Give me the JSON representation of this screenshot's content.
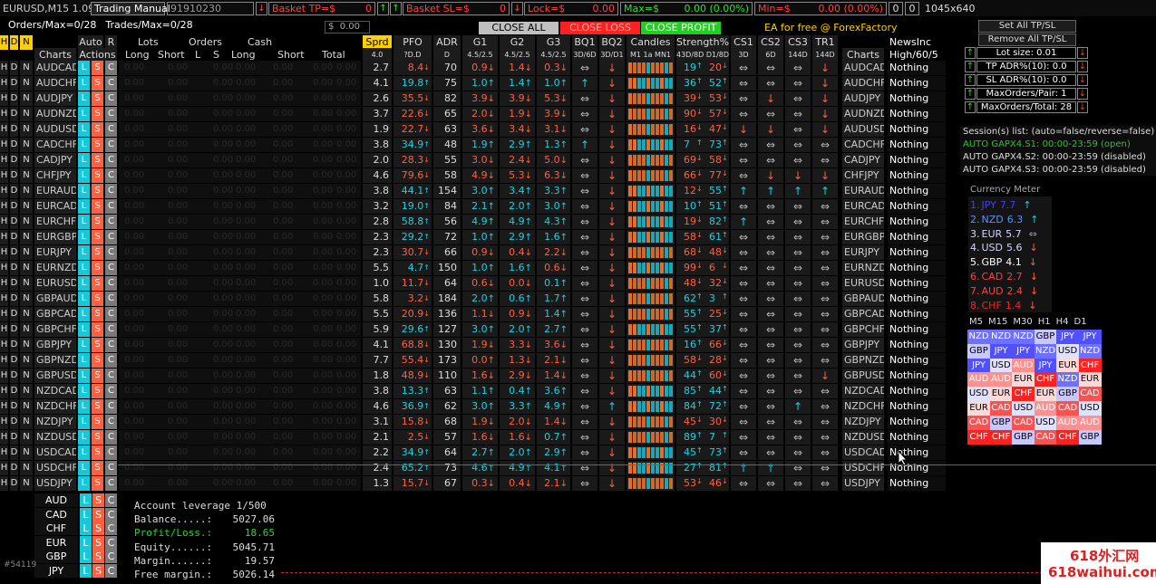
{
  "topbar": {
    "symbol": "EURUSD,M15",
    "version_label": "1.09",
    "trading_manual_label": "Trading Manual",
    "account_field": "91910230",
    "basket_tp_label": "Basket TP=$",
    "basket_tp_value": "0",
    "basket_sl_label": "Basket SL=$",
    "basket_sl_value": "0",
    "lock_label": "Lock=$",
    "lock_value": "0.00",
    "max_label": "Max=$",
    "max_value": "0.00 (0.00%)",
    "min_label": "Min=$",
    "min_value": "0.00 (0.00%)",
    "counter_a": "0",
    "counter_b": "0",
    "resolution": "1045x640"
  },
  "status": {
    "orders": "Orders/Max=0/28",
    "trades": "Trades/Max=0/28",
    "cash_prefix": "$",
    "cash_value": "0.00"
  },
  "actions": {
    "close_all": "CLOSE ALL",
    "close_loss": "CLOSE LOSS",
    "close_profit": "CLOSE PROFIT",
    "ea_free": "EA for free @ ForexFactory"
  },
  "headers": {
    "h": "H",
    "d": "D",
    "n": "N",
    "charts": "Charts",
    "auto": "Auto",
    "r": "R",
    "actions": "Actions",
    "lots": "Lots",
    "orders": "Orders",
    "cash": "Cash",
    "long": "Long",
    "short": "Short",
    "l": "L",
    "s": "S",
    "cash_long": "Long",
    "cash_short": "Short",
    "total": "Total",
    "sprd": "Sprd",
    "sprd_sub": "4.0",
    "pfo": "PFO",
    "pfo_sub": "?D.D",
    "adr": "ADR",
    "adr_sub": "D",
    "g1": "G1",
    "g1_sub": "4.5/2.5",
    "g2": "G2",
    "g2_sub": "4.5/2.5",
    "g3": "G3",
    "g3_sub": "4.5/2.5",
    "bq1": "BQ1",
    "bq1_sub": "3D/6D",
    "bq2": "BQ2",
    "bq2_sub": "3D/D1",
    "candles": "Candles",
    "candles_sub": "M1 1a MN1",
    "strength": "Strength%",
    "strength_sub": "43D/8D D1/8D",
    "cs1": "CS1",
    "cs1_sub": "3D",
    "cs2": "CS2",
    "cs2_sub": "6D",
    "cs3": "CS3",
    "cs3_sub": "144D",
    "tr1": "TR1",
    "tr1_sub": "144D",
    "charts2": "Charts",
    "newsinc": "NewsInc",
    "newsinc_sub": "High/60/5"
  },
  "row_letters": {
    "h": "H",
    "d": "D",
    "n": "N",
    "l": "L",
    "s": "S",
    "c": "C",
    "zero": "0.00",
    "news": "Nothing"
  },
  "pairs": [
    {
      "p": "AUDCAD",
      "sp": "2.7",
      "pfo": "8.4",
      "pc": "salmon",
      "adr": "70",
      "g1": "0.9",
      "g1c": "salmon",
      "g1a": "↓",
      "g2": "1.4",
      "g2c": "salmon",
      "g2a": "↓",
      "g3": "0.3",
      "g3c": "salmon",
      "g3a": "↓",
      "bq1": "⇔",
      "bq2": "↓",
      "s1": "19",
      "s1c": "cyan",
      "s2": "20",
      "s2c": "salmon",
      "cs1": "⇔",
      "cs2": "⇔",
      "cs3": "⇔",
      "tr": "↓"
    },
    {
      "p": "AUDCHF",
      "sp": "4.1",
      "pfo": "19.8",
      "pc": "cyan",
      "adr": "75",
      "g1": "1.0",
      "g1c": "cyan",
      "g1a": "↑",
      "g2": "1.4",
      "g2c": "cyan",
      "g2a": "↑",
      "g3": "1.0",
      "g3c": "cyan",
      "g3a": "↑",
      "bq1": "↑",
      "bq2": "↓",
      "s1": "36",
      "s1c": "cyan",
      "s2": "52",
      "s2c": "cyan",
      "cs1": "⇔",
      "cs2": "⇔",
      "cs3": "⇔",
      "tr": "↓"
    },
    {
      "p": "AUDJPY",
      "sp": "2.6",
      "pfo": "35.5",
      "pc": "salmon",
      "adr": "82",
      "g1": "3.9",
      "g1c": "salmon",
      "g1a": "↓",
      "g2": "3.9",
      "g2c": "salmon",
      "g2a": "↓",
      "g3": "5.3",
      "g3c": "salmon",
      "g3a": "↓",
      "bq1": "⇔",
      "bq2": "↓",
      "s1": "39",
      "s1c": "salmon",
      "s2": "53",
      "s2c": "salmon",
      "cs1": "⇔",
      "cs2": "↓",
      "cs3": "⇔",
      "tr": "↓"
    },
    {
      "p": "AUDNZD",
      "sp": "3.7",
      "pfo": "22.6",
      "pc": "salmon",
      "adr": "65",
      "g1": "2.0",
      "g1c": "salmon",
      "g1a": "↓",
      "g2": "1.9",
      "g2c": "salmon",
      "g2a": "↓",
      "g3": "3.9",
      "g3c": "salmon",
      "g3a": "↓",
      "bq1": "⇔",
      "bq2": "↓",
      "s1": "90",
      "s1c": "salmon",
      "s2": "57",
      "s2c": "salmon",
      "cs1": "⇔",
      "cs2": "⇔",
      "cs3": "⇔",
      "tr": "↓"
    },
    {
      "p": "AUDUSD",
      "sp": "1.9",
      "pfo": "22.7",
      "pc": "salmon",
      "adr": "63",
      "g1": "3.6",
      "g1c": "salmon",
      "g1a": "↓",
      "g2": "3.4",
      "g2c": "salmon",
      "g2a": "↓",
      "g3": "3.1",
      "g3c": "salmon",
      "g3a": "↓",
      "bq1": "⇔",
      "bq2": "↓",
      "s1": "16",
      "s1c": "salmon",
      "s2": "47",
      "s2c": "salmon",
      "cs1": "↓",
      "cs2": "↓",
      "cs3": "⇔",
      "tr": "↓"
    },
    {
      "p": "CADCHF",
      "sp": "3.8",
      "pfo": "34.9",
      "pc": "cyan",
      "adr": "48",
      "g1": "1.9",
      "g1c": "cyan",
      "g1a": "↑",
      "g2": "2.9",
      "g2c": "cyan",
      "g2a": "↑",
      "g3": "1.3",
      "g3c": "cyan",
      "g3a": "↑",
      "bq1": "↑",
      "bq2": "↓",
      "s1": "7",
      "s1c": "cyan",
      "s2": "73",
      "s2c": "cyan",
      "cs1": "⇔",
      "cs2": "⇔",
      "cs3": "⇔",
      "tr": "⇔"
    },
    {
      "p": "CADJPY",
      "sp": "2.0",
      "pfo": "28.3",
      "pc": "salmon",
      "adr": "55",
      "g1": "3.0",
      "g1c": "salmon",
      "g1a": "↓",
      "g2": "2.4",
      "g2c": "salmon",
      "g2a": "↓",
      "g3": "5.0",
      "g3c": "salmon",
      "g3a": "↓",
      "bq1": "⇔",
      "bq2": "↓",
      "s1": "69",
      "s1c": "salmon",
      "s2": "58",
      "s2c": "salmon",
      "cs1": "⇔",
      "cs2": "⇔",
      "cs3": "⇔",
      "tr": "⇔"
    },
    {
      "p": "CHFJPY",
      "sp": "4.6",
      "pfo": "79.6",
      "pc": "salmon",
      "adr": "58",
      "g1": "4.9",
      "g1c": "salmon",
      "g1a": "↓",
      "g2": "5.3",
      "g2c": "salmon",
      "g2a": "↓",
      "g3": "6.3",
      "g3c": "salmon",
      "g3a": "↓",
      "bq1": "⇔",
      "bq2": "↓",
      "s1": "66",
      "s1c": "salmon",
      "s2": "77",
      "s2c": "salmon",
      "cs1": "⇔",
      "cs2": "↓",
      "cs3": "↓",
      "tr": "↓"
    },
    {
      "p": "EURAUD",
      "sp": "3.8",
      "pfo": "44.1",
      "pc": "cyan",
      "adr": "154",
      "g1": "3.0",
      "g1c": "cyan",
      "g1a": "↑",
      "g2": "3.4",
      "g2c": "cyan",
      "g2a": "↑",
      "g3": "3.3",
      "g3c": "cyan",
      "g3a": "↑",
      "bq1": "⇔",
      "bq2": "↓",
      "s1": "12",
      "s1c": "salmon",
      "s2": "55",
      "s2c": "cyan",
      "cs1": "↑",
      "cs2": "↑",
      "cs3": "↑",
      "tr": "↑"
    },
    {
      "p": "EURCAD",
      "sp": "3.2",
      "pfo": "19.0",
      "pc": "cyan",
      "adr": "84",
      "g1": "2.1",
      "g1c": "cyan",
      "g1a": "↑",
      "g2": "2.0",
      "g2c": "cyan",
      "g2a": "↑",
      "g3": "3.0",
      "g3c": "cyan",
      "g3a": "↑",
      "bq1": "⇔",
      "bq2": "↓",
      "s1": "10",
      "s1c": "cyan",
      "s2": "51",
      "s2c": "cyan",
      "cs1": "⇔",
      "cs2": "⇔",
      "cs3": "⇔",
      "tr": "⇔"
    },
    {
      "p": "EURCHF",
      "sp": "2.8",
      "pfo": "58.8",
      "pc": "cyan",
      "adr": "56",
      "g1": "4.9",
      "g1c": "cyan",
      "g1a": "↑",
      "g2": "4.9",
      "g2c": "cyan",
      "g2a": "↑",
      "g3": "4.3",
      "g3c": "cyan",
      "g3a": "↑",
      "bq1": "⇔",
      "bq2": "↓",
      "s1": "19",
      "s1c": "salmon",
      "s2": "82",
      "s2c": "cyan",
      "cs1": "↑",
      "cs2": "⇔",
      "cs3": "⇔",
      "tr": "⇔"
    },
    {
      "p": "EURGBP",
      "sp": "2.3",
      "pfo": "29.2",
      "pc": "cyan",
      "adr": "72",
      "g1": "1.0",
      "g1c": "cyan",
      "g1a": "↑",
      "g2": "2.9",
      "g2c": "cyan",
      "g2a": "↑",
      "g3": "1.6",
      "g3c": "cyan",
      "g3a": "↑",
      "bq1": "⇔",
      "bq2": "↓",
      "s1": "58",
      "s1c": "salmon",
      "s2": "61",
      "s2c": "cyan",
      "cs1": "⇔",
      "cs2": "⇔",
      "cs3": "⇔",
      "tr": "⇔"
    },
    {
      "p": "EURJPY",
      "sp": "2.3",
      "pfo": "30.7",
      "pc": "salmon",
      "adr": "66",
      "g1": "0.9",
      "g1c": "salmon",
      "g1a": "↓",
      "g2": "0.4",
      "g2c": "salmon",
      "g2a": "↓",
      "g3": "2.2",
      "g3c": "salmon",
      "g3a": "↓",
      "bq1": "⇔",
      "bq2": "↓",
      "s1": "68",
      "s1c": "salmon",
      "s2": "48",
      "s2c": "salmon",
      "cs1": "⇔",
      "cs2": "⇔",
      "cs3": "⇔",
      "tr": "⇔"
    },
    {
      "p": "EURNZD",
      "sp": "5.5",
      "pfo": "4.7",
      "pc": "cyan",
      "adr": "150",
      "g1": "1.0",
      "g1c": "cyan",
      "g1a": "↑",
      "g2": "1.6",
      "g2c": "cyan",
      "g2a": "↑",
      "g3": "0.6",
      "g3c": "salmon",
      "g3a": "↓",
      "bq1": "⇔",
      "bq2": "↓",
      "s1": "99",
      "s1c": "salmon",
      "s2": "6",
      "s2c": "salmon",
      "cs1": "⇔",
      "cs2": "⇔",
      "cs3": "⇔",
      "tr": "⇔"
    },
    {
      "p": "EURUSD",
      "sp": "1.0",
      "pfo": "11.7",
      "pc": "salmon",
      "adr": "64",
      "g1": "0.6",
      "g1c": "salmon",
      "g1a": "↓",
      "g2": "0.0",
      "g2c": "salmon",
      "g2a": "↓",
      "g3": "0.1",
      "g3c": "cyan",
      "g3a": "↑",
      "bq1": "⇔",
      "bq2": "↓",
      "s1": "48",
      "s1c": "salmon",
      "s2": "32",
      "s2c": "salmon",
      "cs1": "⇔",
      "cs2": "⇔",
      "cs3": "⇔",
      "tr": "⇔"
    },
    {
      "p": "GBPAUD",
      "sp": "5.8",
      "pfo": "3.2",
      "pc": "salmon",
      "adr": "184",
      "g1": "2.0",
      "g1c": "cyan",
      "g1a": "↑",
      "g2": "0.6",
      "g2c": "cyan",
      "g2a": "↑",
      "g3": "1.7",
      "g3c": "cyan",
      "g3a": "↑",
      "bq1": "⇔",
      "bq2": "↓",
      "s1": "62",
      "s1c": "cyan",
      "s2": "3",
      "s2c": "cyan",
      "cs1": "⇔",
      "cs2": "⇔",
      "cs3": "⇔",
      "tr": "⇔"
    },
    {
      "p": "GBPCAD",
      "sp": "5.5",
      "pfo": "20.9",
      "pc": "salmon",
      "adr": "136",
      "g1": "1.1",
      "g1c": "salmon",
      "g1a": "↓",
      "g2": "0.9",
      "g2c": "salmon",
      "g2a": "↓",
      "g3": "1.4",
      "g3c": "cyan",
      "g3a": "↑",
      "bq1": "⇔",
      "bq2": "↓",
      "s1": "55",
      "s1c": "cyan",
      "s2": "25",
      "s2c": "salmon",
      "cs1": "⇔",
      "cs2": "⇔",
      "cs3": "⇔",
      "tr": "⇔"
    },
    {
      "p": "GBPCHF",
      "sp": "5.9",
      "pfo": "29.6",
      "pc": "cyan",
      "adr": "127",
      "g1": "3.0",
      "g1c": "cyan",
      "g1a": "↑",
      "g2": "2.0",
      "g2c": "cyan",
      "g2a": "↑",
      "g3": "2.7",
      "g3c": "cyan",
      "g3a": "↑",
      "bq1": "⇔",
      "bq2": "↓",
      "s1": "55",
      "s1c": "cyan",
      "s2": "37",
      "s2c": "cyan",
      "cs1": "⇔",
      "cs2": "⇔",
      "cs3": "⇔",
      "tr": "⇔"
    },
    {
      "p": "GBPJPY",
      "sp": "4.1",
      "pfo": "68.8",
      "pc": "salmon",
      "adr": "130",
      "g1": "1.9",
      "g1c": "salmon",
      "g1a": "↓",
      "g2": "3.3",
      "g2c": "salmon",
      "g2a": "↓",
      "g3": "3.6",
      "g3c": "salmon",
      "g3a": "↓",
      "bq1": "⇔",
      "bq2": "↓",
      "s1": "16",
      "s1c": "cyan",
      "s2": "66",
      "s2c": "salmon",
      "cs1": "⇔",
      "cs2": "⇔",
      "cs3": "⇔",
      "tr": "⇔"
    },
    {
      "p": "GBPNZD",
      "sp": "7.7",
      "pfo": "55.4",
      "pc": "salmon",
      "adr": "173",
      "g1": "0.0",
      "g1c": "salmon",
      "g1a": "↑",
      "g2": "1.3",
      "g2c": "salmon",
      "g2a": "↓",
      "g3": "2.1",
      "g3c": "salmon",
      "g3a": "↓",
      "bq1": "⇔",
      "bq2": "↓",
      "s1": "58",
      "s1c": "salmon",
      "s2": "28",
      "s2c": "salmon",
      "cs1": "⇔",
      "cs2": "⇔",
      "cs3": "⇔",
      "tr": "⇔"
    },
    {
      "p": "GBPUSD",
      "sp": "1.8",
      "pfo": "48.9",
      "pc": "salmon",
      "adr": "110",
      "g1": "1.6",
      "g1c": "salmon",
      "g1a": "↓",
      "g2": "2.9",
      "g2c": "salmon",
      "g2a": "↓",
      "g3": "1.4",
      "g3c": "salmon",
      "g3a": "↓",
      "bq1": "⇔",
      "bq2": "↓",
      "s1": "44",
      "s1c": "cyan",
      "s2": "60",
      "s2c": "salmon",
      "cs1": "⇔",
      "cs2": "⇔",
      "cs3": "⇔",
      "tr": "↓"
    },
    {
      "p": "NZDCAD",
      "sp": "3.8",
      "pfo": "13.3",
      "pc": "cyan",
      "adr": "63",
      "g1": "1.1",
      "g1c": "cyan",
      "g1a": "↑",
      "g2": "0.4",
      "g2c": "cyan",
      "g2a": "↑",
      "g3": "3.6",
      "g3c": "cyan",
      "g3a": "↑",
      "bq1": "⇔",
      "bq2": "↓",
      "s1": "85",
      "s1c": "cyan",
      "s2": "44",
      "s2c": "cyan",
      "cs1": "⇔",
      "cs2": "⇔",
      "cs3": "⇔",
      "tr": "⇔"
    },
    {
      "p": "NZDCHF",
      "sp": "4.6",
      "pfo": "36.9",
      "pc": "cyan",
      "adr": "62",
      "g1": "3.0",
      "g1c": "cyan",
      "g1a": "↑",
      "g2": "3.3",
      "g2c": "cyan",
      "g2a": "↑",
      "g3": "4.9",
      "g3c": "cyan",
      "g3a": "↑",
      "bq1": "⇔",
      "bq2": "↑",
      "s1": "84",
      "s1c": "cyan",
      "s2": "72",
      "s2c": "cyan",
      "cs1": "⇔",
      "cs2": "⇔",
      "cs3": "↑",
      "tr": "⇔"
    },
    {
      "p": "NZDJPY",
      "sp": "3.1",
      "pfo": "15.8",
      "pc": "salmon",
      "adr": "68",
      "g1": "1.9",
      "g1c": "salmon",
      "g1a": "↓",
      "g2": "2.0",
      "g2c": "salmon",
      "g2a": "↓",
      "g3": "1.4",
      "g3c": "salmon",
      "g3a": "↓",
      "bq1": "⇔",
      "bq2": "↓",
      "s1": "45",
      "s1c": "salmon",
      "s2": "30",
      "s2c": "salmon",
      "cs1": "⇔",
      "cs2": "⇔",
      "cs3": "⇔",
      "tr": "⇔"
    },
    {
      "p": "NZDUSD",
      "sp": "2.1",
      "pfo": "2.5",
      "pc": "salmon",
      "adr": "57",
      "g1": "1.6",
      "g1c": "salmon",
      "g1a": "↓",
      "g2": "1.6",
      "g2c": "salmon",
      "g2a": "↓",
      "g3": "0.7",
      "g3c": "cyan",
      "g3a": "↑",
      "bq1": "⇔",
      "bq2": "↓",
      "s1": "89",
      "s1c": "cyan",
      "s2": "7",
      "s2c": "cyan",
      "cs1": "⇔",
      "cs2": "⇔",
      "cs3": "⇔",
      "tr": "⇔"
    },
    {
      "p": "USDCAD",
      "sp": "2.2",
      "pfo": "34.9",
      "pc": "cyan",
      "adr": "64",
      "g1": "2.7",
      "g1c": "cyan",
      "g1a": "↑",
      "g2": "2.0",
      "g2c": "cyan",
      "g2a": "↑",
      "g3": "2.9",
      "g3c": "cyan",
      "g3a": "↑",
      "bq1": "⇔",
      "bq2": "↓",
      "s1": "45",
      "s1c": "cyan",
      "s2": "73",
      "s2c": "cyan",
      "cs1": "⇔",
      "cs2": "⇔",
      "cs3": "⇔",
      "tr": "⇔"
    },
    {
      "p": "USDCHF",
      "sp": "2.4",
      "pfo": "65.2",
      "pc": "cyan",
      "adr": "73",
      "g1": "4.6",
      "g1c": "cyan",
      "g1a": "↑",
      "g2": "4.9",
      "g2c": "cyan",
      "g2a": "↑",
      "g3": "4.1",
      "g3c": "cyan",
      "g3a": "↑",
      "bq1": "⇔",
      "bq2": "↓",
      "s1": "27",
      "s1c": "cyan",
      "s2": "81",
      "s2c": "cyan",
      "cs1": "↑",
      "cs2": "↑",
      "cs3": "⇔",
      "tr": "⇔"
    },
    {
      "p": "USDJPY",
      "sp": "1.3",
      "pfo": "15.7",
      "pc": "salmon",
      "adr": "67",
      "g1": "0.3",
      "g1c": "salmon",
      "g1a": "↓",
      "g2": "0.4",
      "g2c": "salmon",
      "g2a": "↓",
      "g3": "2.1",
      "g3c": "salmon",
      "g3a": "↓",
      "bq1": "⇔",
      "bq2": "↓",
      "s1": "53",
      "s1c": "salmon",
      "s2": "46",
      "s2c": "salmon",
      "cs1": "⇔",
      "cs2": "⇔",
      "cs3": "⇔",
      "tr": "⇔"
    }
  ],
  "right_panel": {
    "set_all": "Set All TP/SL",
    "remove_all": "Remove All TP/SL",
    "lot_size": "Lot size: 0.01",
    "tp_adr": "TP ADR%(10): 0.0",
    "sl_adr": "SL ADR%(10): 0.0",
    "max_orders_pair": "MaxOrders/Pair: 1",
    "max_orders_total": "MaxOrders/Total: 28",
    "sessions_title": "Session(s) list: (auto=false/reverse=false)",
    "session1": "AUTO GAPX4.S1: 00:00-23:59 (open)",
    "session2": "AUTO GAPX4.S2: 00:00-23:59 (disabled)",
    "session3": "AUTO GAPX4.S3: 00:00-23:59 (disabled)",
    "meter_title": "Currency Meter",
    "meter": [
      {
        "rank": "1.",
        "cur": "JPY",
        "val": "7.7",
        "color": "#4040ff",
        "arrow": "↑",
        "ac": "cyan"
      },
      {
        "rank": "2.",
        "cur": "NZD",
        "val": "6.3",
        "color": "#6090ff",
        "arrow": "↑",
        "ac": "cyan"
      },
      {
        "rank": "3.",
        "cur": "EUR",
        "val": "5.7",
        "color": "#d0d8ff",
        "arrow": "⇔",
        "ac": "gray"
      },
      {
        "rank": "4.",
        "cur": "USD",
        "val": "5.6",
        "color": "#d0d8ff",
        "arrow": "↓",
        "ac": "salmon"
      },
      {
        "rank": "5.",
        "cur": "GBP",
        "val": "4.1",
        "color": "#ffffff",
        "arrow": "↓",
        "ac": "salmon"
      },
      {
        "rank": "6.",
        "cur": "CAD",
        "val": "2.7",
        "color": "#ff4040",
        "arrow": "↓",
        "ac": "salmon"
      },
      {
        "rank": "7.",
        "cur": "AUD",
        "val": "2.4",
        "color": "#ff4040",
        "arrow": "↓",
        "ac": "salmon"
      },
      {
        "rank": "8.",
        "cur": "CHF",
        "val": "1.4",
        "color": "#ff2020",
        "arrow": "↓",
        "ac": "salmon"
      }
    ],
    "tf_labels": [
      "M5",
      "M15",
      "M30",
      "H1",
      "H4",
      "D1"
    ],
    "tf_grid": [
      [
        "NZD",
        "NZD",
        "NZD",
        "GBP",
        "JPY",
        "JPY"
      ],
      [
        "GBP",
        "JPY",
        "JPY",
        "NZD",
        "USD",
        "NZD"
      ],
      [
        "JPY",
        "USD",
        "AUD",
        "JPY",
        "EUR",
        "CHF"
      ],
      [
        "AUD",
        "AUD",
        "EUR",
        "CHF",
        "NZD",
        "EUR"
      ],
      [
        "USD",
        "EUR",
        "CHF",
        "EUR",
        "GBP",
        "CAD"
      ],
      [
        "EUR",
        "CAD",
        "USD",
        "AUD",
        "CAD",
        "USD"
      ],
      [
        "CAD",
        "GBP",
        "CAD",
        "USD",
        "AUD",
        "AUD"
      ],
      [
        "CHF",
        "CHF",
        "GBP",
        "CAD",
        "CHF",
        "GBP"
      ]
    ]
  },
  "bottom": {
    "currencies": [
      "AUD",
      "CAD",
      "CHF",
      "EUR",
      "GBP",
      "JPY"
    ],
    "leverage": "Account leverage 1/500",
    "balance_label": "Balance.....:",
    "balance": "5027.06",
    "pl_label": "Profit/Loss.:",
    "pl": "18.65",
    "equity_label": "Equity......:",
    "equity": "5045.71",
    "margin_label": "Margin......:",
    "margin": "19.57",
    "free_label": "Free margin.:",
    "free": "5026.14",
    "account_number": "#54119"
  },
  "watermark": {
    "line1": "618外汇网",
    "line2": "618waihui.com"
  }
}
